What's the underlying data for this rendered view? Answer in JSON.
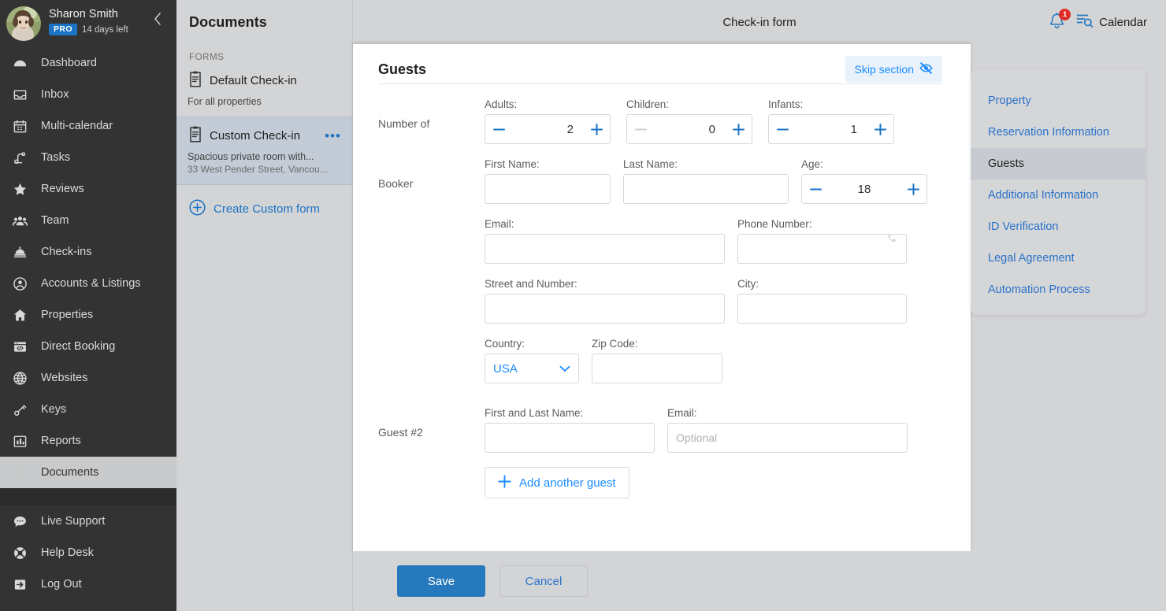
{
  "colors": {
    "sidebar_bg": "#333333",
    "panel_bg": "#d3d4d6",
    "accent_blue": "#1a73c4",
    "link_blue": "#2a73c9",
    "badge_red": "#e02b27",
    "selected_form": "#c2cbd6",
    "save_button": "#2779bd"
  },
  "sidebar": {
    "profile": {
      "name": "Sharon Smith",
      "badge": "PRO",
      "trial": "14 days left",
      "avatar_icon": "user-avatar-photo",
      "collapse_icon": "chevron-left-icon"
    },
    "items": [
      {
        "label": "Dashboard",
        "icon": "dashboard-gauge-icon",
        "active": false
      },
      {
        "label": "Inbox",
        "icon": "inbox-tray-icon",
        "active": false
      },
      {
        "label": "Multi-calendar",
        "icon": "calendar-grid-icon",
        "active": false
      },
      {
        "label": "Tasks",
        "icon": "tasks-icon",
        "active": false
      },
      {
        "label": "Reviews",
        "icon": "star-icon",
        "active": false
      },
      {
        "label": "Team",
        "icon": "people-group-icon",
        "active": false
      },
      {
        "label": "Check-ins",
        "icon": "bell-desk-icon",
        "active": false
      },
      {
        "label": "Accounts & Listings",
        "icon": "user-circle-icon",
        "active": false
      },
      {
        "label": "Properties",
        "icon": "home-icon",
        "active": false
      },
      {
        "label": "Direct Booking",
        "icon": "browser-code-icon",
        "active": false
      },
      {
        "label": "Websites",
        "icon": "globe-icon",
        "active": false
      },
      {
        "label": "Keys",
        "icon": "key-icon",
        "active": false
      },
      {
        "label": "Reports",
        "icon": "bar-chart-icon",
        "active": false
      },
      {
        "label": "Documents",
        "icon": "document-icon",
        "active": true
      }
    ],
    "bottom_items": [
      {
        "label": "Live Support",
        "icon": "chat-bubble-icon"
      },
      {
        "label": "Help Desk",
        "icon": "lifebuoy-icon"
      },
      {
        "label": "Log Out",
        "icon": "logout-arrow-icon"
      }
    ]
  },
  "documents_panel": {
    "title": "Documents",
    "section_label": "FORMS",
    "forms": [
      {
        "name": "Default Check-in",
        "subtitle": "For all properties",
        "address": "",
        "icon": "clipboard-icon",
        "selected": false,
        "has_menu": false
      },
      {
        "name": "Custom Check-in",
        "subtitle": "Spacious private room with...",
        "address": "33 West Pender Street, Vancou...",
        "icon": "clipboard-icon",
        "selected": true,
        "has_menu": true,
        "menu_icon": "more-options-icon"
      }
    ],
    "create_label": "Create Custom form",
    "create_icon": "plus-circle-icon"
  },
  "header": {
    "title": "Check-in form",
    "notification": {
      "icon": "bell-icon",
      "count": "1"
    },
    "calendar": {
      "label": "Calendar",
      "icon": "calendar-search-icon"
    }
  },
  "form": {
    "section_title": "Guests",
    "skip_label": "Skip section",
    "skip_icon": "eye-slash-icon",
    "number_of": {
      "row_label": "Number of",
      "steppers": [
        {
          "label": "Adults:",
          "value": "2",
          "minus_disabled": false
        },
        {
          "label": "Children:",
          "value": "0",
          "minus_disabled": true
        },
        {
          "label": "Infants:",
          "value": "1",
          "minus_disabled": false
        }
      ],
      "minus_icon": "minus-icon",
      "plus_icon": "plus-icon"
    },
    "booker": {
      "row_label": "Booker",
      "first_name": {
        "label": "First Name:",
        "value": "",
        "placeholder": ""
      },
      "last_name": {
        "label": "Last Name:",
        "value": "",
        "placeholder": ""
      },
      "age": {
        "label": "Age:",
        "value": "18"
      },
      "email": {
        "label": "Email:",
        "value": "",
        "placeholder": ""
      },
      "phone": {
        "label": "Phone Number:",
        "value": "",
        "placeholder": "",
        "icon": "phone-icon"
      },
      "street": {
        "label": "Street and Number:",
        "value": "",
        "placeholder": ""
      },
      "city": {
        "label": "City:",
        "value": "",
        "placeholder": ""
      },
      "country": {
        "label": "Country:",
        "value": "USA",
        "chevron_icon": "chevron-down-icon"
      },
      "zip": {
        "label": "Zip Code:",
        "value": "",
        "placeholder": ""
      }
    },
    "guest2": {
      "row_label": "Guest #2",
      "name": {
        "label": "First and Last Name:",
        "value": "",
        "placeholder": ""
      },
      "email": {
        "label": "Email:",
        "value": "",
        "placeholder": "Optional"
      },
      "add_guest_label": "Add another guest",
      "add_guest_icon": "plus-icon"
    }
  },
  "section_nav": {
    "items": [
      {
        "label": "Property",
        "active": false
      },
      {
        "label": "Reservation Information",
        "active": false
      },
      {
        "label": "Guests",
        "active": true
      },
      {
        "label": "Additional Information",
        "active": false
      },
      {
        "label": "ID Verification",
        "active": false
      },
      {
        "label": "Legal Agreement",
        "active": false
      },
      {
        "label": "Automation Process",
        "active": false
      }
    ]
  },
  "footer": {
    "save_label": "Save",
    "cancel_label": "Cancel"
  }
}
